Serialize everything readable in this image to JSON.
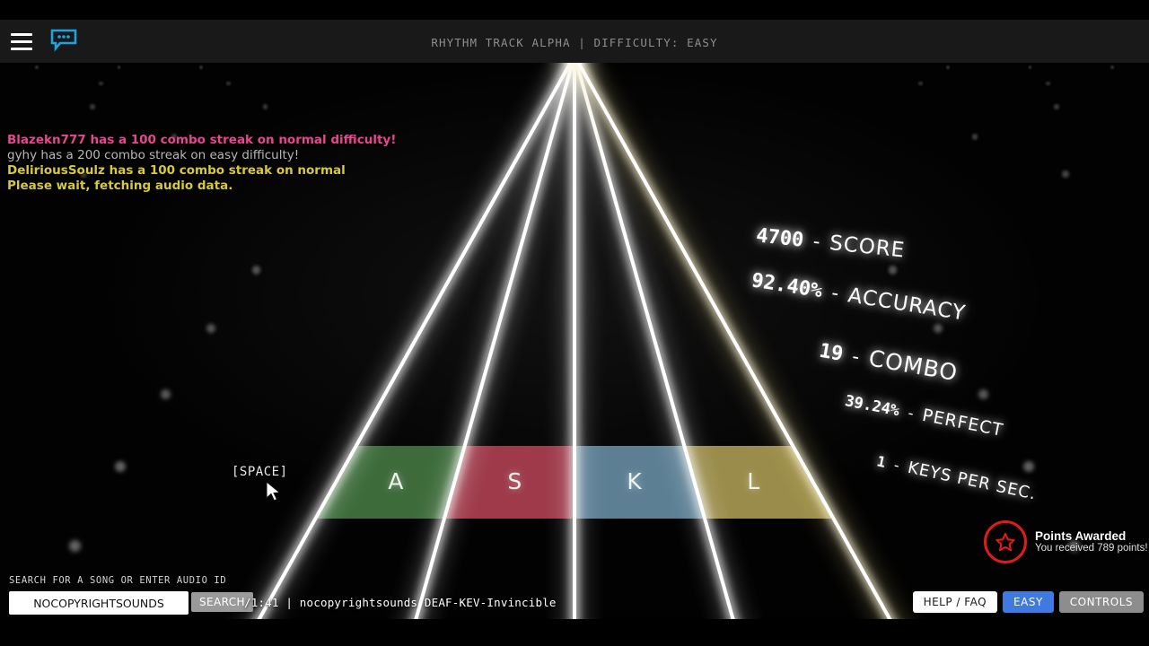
{
  "topbar": {
    "menu_icon": "hamburger-menu-icon",
    "chat_icon": "chat-bubble-icon",
    "title": "RHYTHM TRACK ALPHA | DIFFICULTY: EASY"
  },
  "chat": {
    "messages": [
      {
        "text": "Blazekn777 has a 100 combo streak on normal difficulty!",
        "color": "#e8468f",
        "bold": true
      },
      {
        "text": "gyhy has a 200 combo streak on easy difficulty!",
        "color": "#b7b7b7",
        "bold": false
      },
      {
        "text": "DeliriousSoulz has a 100 combo streak on normal",
        "color": "#d8c93c",
        "bold": true
      },
      {
        "text": "Please wait, fetching audio data.",
        "color": "#d8c93c",
        "bold": true
      }
    ]
  },
  "stats": [
    {
      "value": "4700",
      "label": "SCORE"
    },
    {
      "value": "92.40%",
      "label": "ACCURACY"
    },
    {
      "value": "19",
      "label": "COMBO"
    },
    {
      "value": "39.24%",
      "label": "PERFECT"
    },
    {
      "value": "1",
      "label": "KEYS PER SEC."
    }
  ],
  "points": {
    "icon": "star-award-icon",
    "title": "Points Awarded",
    "subtitle": "You received 789 points!",
    "accent": "#e01b1b"
  },
  "lanes": [
    {
      "key": "A",
      "color": "#3d6b3a"
    },
    {
      "key": "S",
      "color": "#9e3a4a"
    },
    {
      "key": "K",
      "color": "#5c7f94"
    },
    {
      "key": "L",
      "color": "#9a8c4a"
    }
  ],
  "space_label": "[SPACE]",
  "cursor_icon": "mouse-pointer-icon",
  "search": {
    "label": "SEARCH FOR A SONG OR ENTER AUDIO ID",
    "value": "NOCOPYRIGHTSOUNDS",
    "placeholder": "NOCOPYRIGHTSOUNDS",
    "button": "SEARCH"
  },
  "track_info": "/1:41 | nocopyrightsounds DEAF-KEV-Invincible",
  "bottom_buttons": [
    {
      "label": "HELP / FAQ",
      "style": "help"
    },
    {
      "label": "EASY",
      "style": "easy"
    },
    {
      "label": "CONTROLS",
      "style": "controls"
    }
  ]
}
